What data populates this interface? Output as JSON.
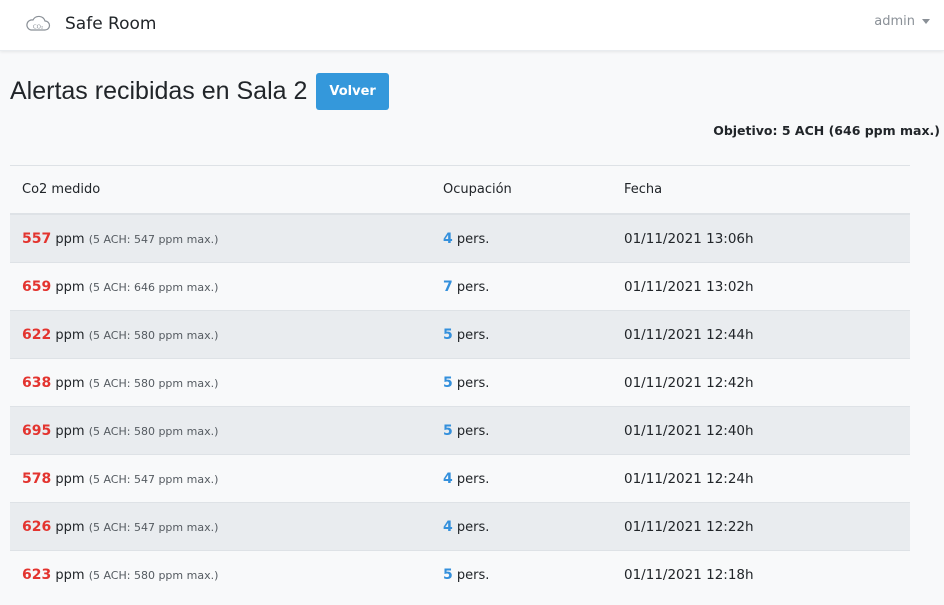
{
  "app": {
    "brand": "Safe Room",
    "logo_icon": "cloud-co2-icon"
  },
  "user": {
    "name": "admin"
  },
  "page": {
    "title": "Alertas recibidas en Sala 2",
    "back_label": "Volver",
    "objective": "Objetivo: 5 ACH (646 ppm max.)"
  },
  "table": {
    "headers": [
      "Co2 medido",
      "Ocupación",
      "Fecha"
    ],
    "rows": [
      {
        "co2": "557",
        "unit": "ppm",
        "limit": "(5 ACH: 547 ppm max.)",
        "occupancy": "4",
        "occ_unit": "pers.",
        "date": "01/11/2021 13:06h"
      },
      {
        "co2": "659",
        "unit": "ppm",
        "limit": "(5 ACH: 646 ppm max.)",
        "occupancy": "7",
        "occ_unit": "pers.",
        "date": "01/11/2021 13:02h"
      },
      {
        "co2": "622",
        "unit": "ppm",
        "limit": "(5 ACH: 580 ppm max.)",
        "occupancy": "5",
        "occ_unit": "pers.",
        "date": "01/11/2021 12:44h"
      },
      {
        "co2": "638",
        "unit": "ppm",
        "limit": "(5 ACH: 580 ppm max.)",
        "occupancy": "5",
        "occ_unit": "pers.",
        "date": "01/11/2021 12:42h"
      },
      {
        "co2": "695",
        "unit": "ppm",
        "limit": "(5 ACH: 580 ppm max.)",
        "occupancy": "5",
        "occ_unit": "pers.",
        "date": "01/11/2021 12:40h"
      },
      {
        "co2": "578",
        "unit": "ppm",
        "limit": "(5 ACH: 547 ppm max.)",
        "occupancy": "4",
        "occ_unit": "pers.",
        "date": "01/11/2021 12:24h"
      },
      {
        "co2": "626",
        "unit": "ppm",
        "limit": "(5 ACH: 547 ppm max.)",
        "occupancy": "4",
        "occ_unit": "pers.",
        "date": "01/11/2021 12:22h"
      },
      {
        "co2": "623",
        "unit": "ppm",
        "limit": "(5 ACH: 580 ppm max.)",
        "occupancy": "5",
        "occ_unit": "pers.",
        "date": "01/11/2021 12:18h"
      }
    ]
  },
  "colors": {
    "accent": "#3498db",
    "co2_alert": "#e3342f",
    "occupancy": "#3490dc"
  }
}
